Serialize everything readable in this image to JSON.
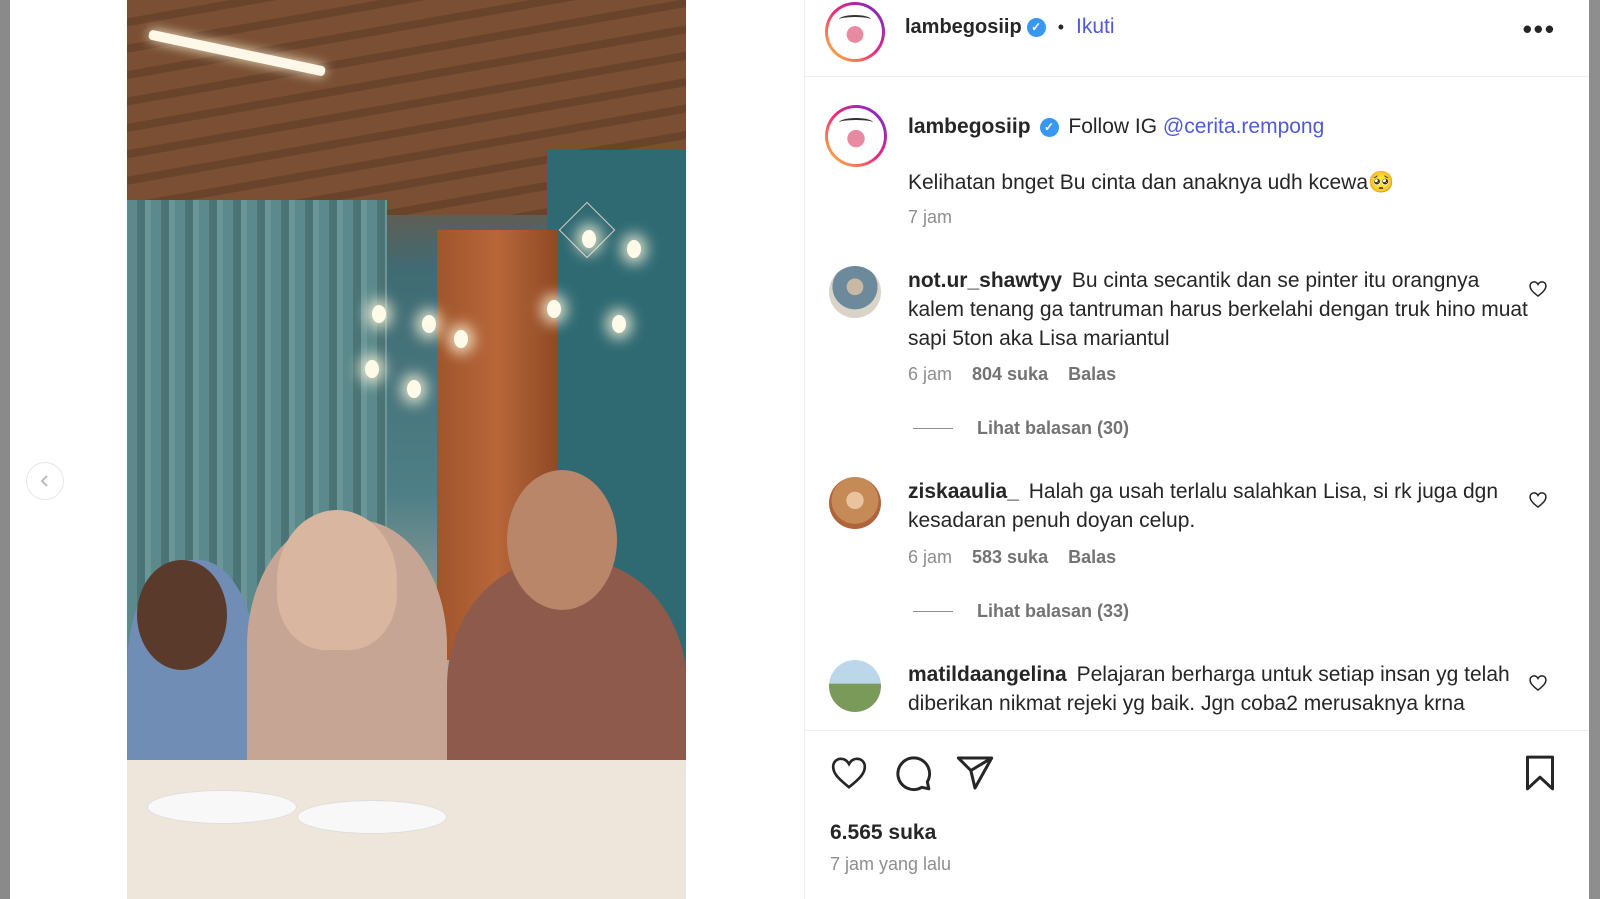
{
  "header": {
    "username": "lambegosiip",
    "separator": "•",
    "follow_label": "Ikuti",
    "more_label": "•••"
  },
  "caption": {
    "username": "lambegosiip",
    "text_prefix": "Follow IG",
    "mention": "@cerita.rempong",
    "body": "Kelihatan bnget Bu cinta dan anaknya udh kcewa🥺",
    "time": "7 jam"
  },
  "comments": [
    {
      "username": "not.ur_shawtyy",
      "text": "Bu cinta secantik dan se pinter itu orangnya kalem tenang ga tantruman harus berkelahi dengan truk hino muat sapi 5ton aka Lisa mariantul",
      "time": "6 jam",
      "likes": "804 suka",
      "reply": "Balas",
      "view_replies": "Lihat balasan (30)"
    },
    {
      "username": "ziskaaulia_",
      "text": "Halah ga usah terlalu salahkan Lisa, si rk juga dgn kesadaran penuh doyan celup.",
      "time": "6 jam",
      "likes": "583 suka",
      "reply": "Balas",
      "view_replies": "Lihat balasan (33)"
    },
    {
      "username": "matildaangelina",
      "text": "Pelajaran berharga untuk setiap insan yg telah diberikan nikmat rejeki yg baik. Jgn coba2 merusaknya krna"
    }
  ],
  "footer": {
    "likes": "6.565 suka",
    "time_ago": "7 jam yang lalu"
  },
  "icons": {
    "verified": "verified-badge-icon",
    "like": "heart-icon",
    "comment": "comment-icon",
    "share": "send-icon",
    "save": "bookmark-icon",
    "prev": "chevron-left-icon"
  },
  "colors": {
    "link": "#4f5bd5",
    "verified": "#3897f0",
    "muted": "#8e8e8e",
    "text": "#262626"
  }
}
